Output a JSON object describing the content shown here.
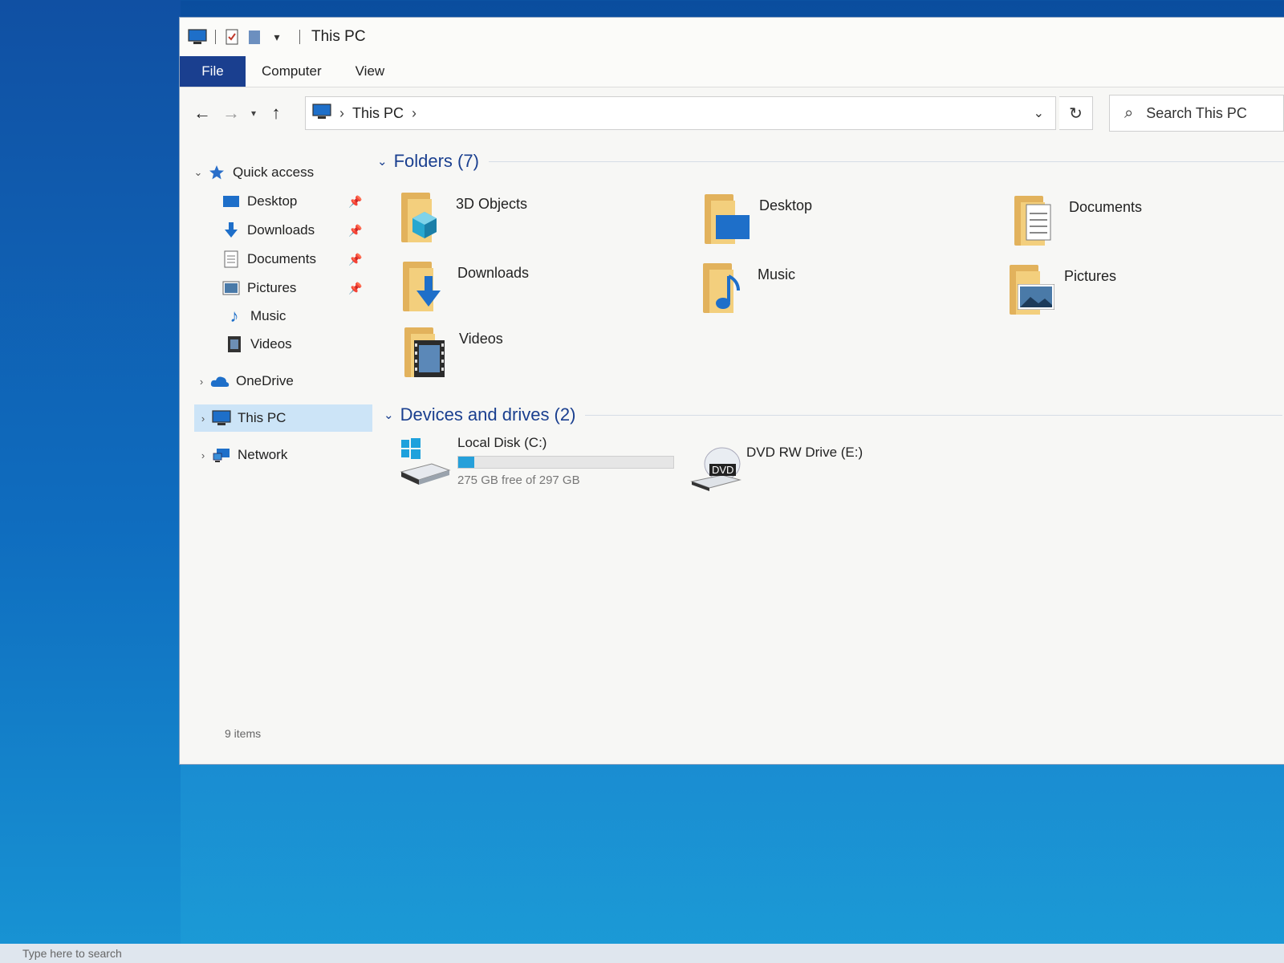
{
  "window": {
    "title": "This PC"
  },
  "ribbon": {
    "tabs": [
      "File",
      "Computer",
      "View"
    ]
  },
  "address": {
    "crumb": "This PC",
    "refresh_icon": "refresh-icon",
    "dropdown_icon": "chevron-down-icon"
  },
  "search": {
    "placeholder": "Search This PC"
  },
  "navpane": {
    "quick_access": "Quick access",
    "items": [
      {
        "label": "Desktop",
        "icon": "desktop-icon",
        "pinned": true
      },
      {
        "label": "Downloads",
        "icon": "download-arrow-icon",
        "pinned": true
      },
      {
        "label": "Documents",
        "icon": "document-icon",
        "pinned": true
      },
      {
        "label": "Pictures",
        "icon": "picture-icon",
        "pinned": true
      },
      {
        "label": "Music",
        "icon": "music-note-icon",
        "pinned": false
      },
      {
        "label": "Videos",
        "icon": "film-icon",
        "pinned": false
      }
    ],
    "onedrive": "OneDrive",
    "this_pc": "This PC",
    "network": "Network"
  },
  "content": {
    "folders_header": "Folders (7)",
    "folders": [
      {
        "name": "3D Objects",
        "icon": "cube-icon"
      },
      {
        "name": "Desktop",
        "icon": "desktop-icon"
      },
      {
        "name": "Documents",
        "icon": "document-icon"
      },
      {
        "name": "Downloads",
        "icon": "download-arrow-icon"
      },
      {
        "name": "Music",
        "icon": "music-note-icon"
      },
      {
        "name": "Pictures",
        "icon": "picture-icon"
      },
      {
        "name": "Videos",
        "icon": "film-icon"
      }
    ],
    "devices_header": "Devices and drives (2)",
    "drives": [
      {
        "name": "Local Disk (C:)",
        "free_text": "275 GB free of 297 GB",
        "used_fraction": 0.074
      },
      {
        "name": "DVD RW Drive (E:)",
        "badge": "DVD"
      }
    ]
  },
  "status": {
    "items": "9 items"
  },
  "taskbar": {
    "search_hint": "Type here to search"
  },
  "colors": {
    "accent": "#1a3f8f",
    "selection": "#cce4f7",
    "folder": "#f3cf7d",
    "usage_fill": "#26a0da"
  }
}
